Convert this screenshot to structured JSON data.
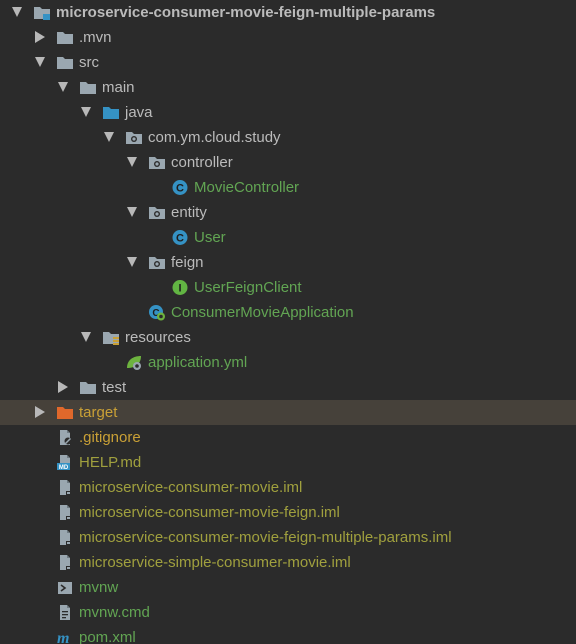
{
  "colors": {
    "background": "#2b2b2b",
    "selected_row": "#46413a",
    "default_text": "#bbbbbb",
    "vcs_new_text": "#62a553",
    "ignored_text": "#c9a036",
    "unversioned_text": "#a0a03e",
    "excluded_folder": "#e0682b"
  },
  "tree": [
    {
      "label": "microservice-consumer-movie-feign-multiple-params",
      "icon": "module-folder-icon",
      "expanded": true,
      "bold": true,
      "color": "#bbbbbb"
    },
    {
      "label": ".mvn",
      "icon": "folder-icon",
      "expanded": false,
      "color": "#bbbbbb"
    },
    {
      "label": "src",
      "icon": "folder-icon",
      "expanded": true,
      "color": "#bbbbbb"
    },
    {
      "label": "main",
      "icon": "folder-icon",
      "expanded": true,
      "color": "#bbbbbb"
    },
    {
      "label": "java",
      "icon": "source-root-folder-icon",
      "expanded": true,
      "color": "#bbbbbb"
    },
    {
      "label": "com.ym.cloud.study",
      "icon": "package-icon",
      "expanded": true,
      "color": "#bbbbbb"
    },
    {
      "label": "controller",
      "icon": "package-icon",
      "expanded": true,
      "color": "#bbbbbb"
    },
    {
      "label": "MovieController",
      "icon": "class-icon",
      "color": "#62a553"
    },
    {
      "label": "entity",
      "icon": "package-icon",
      "expanded": true,
      "color": "#bbbbbb"
    },
    {
      "label": "User",
      "icon": "class-icon",
      "color": "#62a553"
    },
    {
      "label": "feign",
      "icon": "package-icon",
      "expanded": true,
      "color": "#bbbbbb"
    },
    {
      "label": "UserFeignClient",
      "icon": "interface-icon",
      "color": "#62a553"
    },
    {
      "label": "ConsumerMovieApplication",
      "icon": "spring-boot-class-icon",
      "color": "#62a553"
    },
    {
      "label": "resources",
      "icon": "resources-folder-icon",
      "expanded": true,
      "color": "#bbbbbb"
    },
    {
      "label": "application.yml",
      "icon": "spring-config-icon",
      "color": "#62a553"
    },
    {
      "label": "test",
      "icon": "folder-icon",
      "expanded": false,
      "color": "#bbbbbb"
    },
    {
      "label": "target",
      "icon": "excluded-folder-icon",
      "expanded": false,
      "color": "#c9a036",
      "selected": true
    },
    {
      "label": ".gitignore",
      "icon": "gitignore-file-icon",
      "color": "#c9a036"
    },
    {
      "label": "HELP.md",
      "icon": "markdown-file-icon",
      "color": "#a0a03e"
    },
    {
      "label": "microservice-consumer-movie.iml",
      "icon": "iml-file-icon",
      "color": "#a0a03e"
    },
    {
      "label": "microservice-consumer-movie-feign.iml",
      "icon": "iml-file-icon",
      "color": "#a0a03e"
    },
    {
      "label": "microservice-consumer-movie-feign-multiple-params.iml",
      "icon": "iml-file-icon",
      "color": "#a0a03e"
    },
    {
      "label": "microservice-simple-consumer-movie.iml",
      "icon": "iml-file-icon",
      "color": "#a0a03e"
    },
    {
      "label": "mvnw",
      "icon": "shell-script-icon",
      "color": "#62a553"
    },
    {
      "label": "mvnw.cmd",
      "icon": "text-file-icon",
      "color": "#62a553"
    },
    {
      "label": "pom.xml",
      "icon": "maven-pom-icon",
      "color": "#62a553"
    }
  ]
}
